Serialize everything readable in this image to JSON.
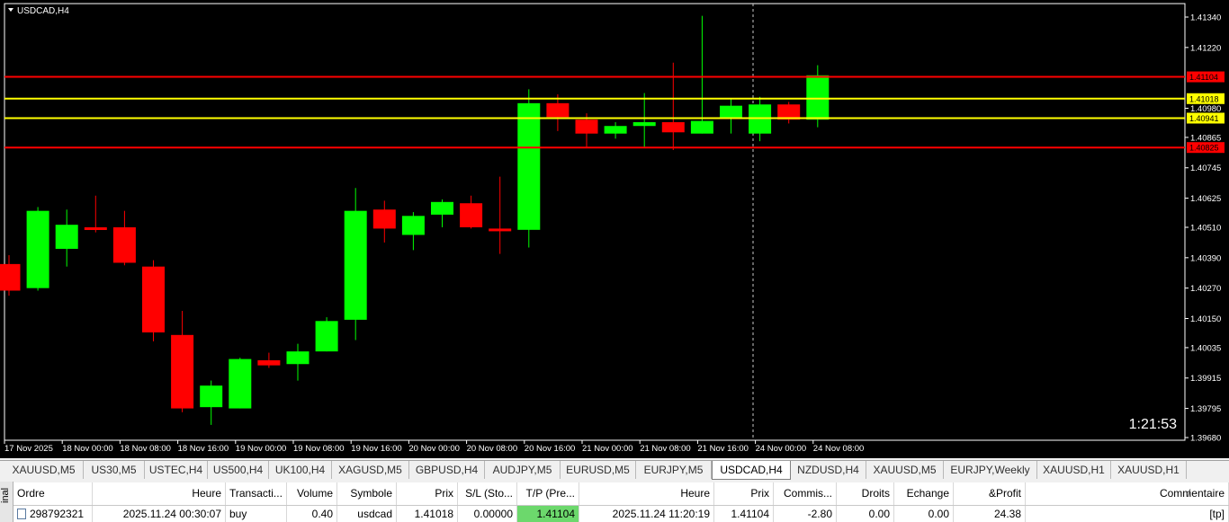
{
  "chart": {
    "title": "USDCAD,H4",
    "countdown": "1:21:53",
    "price_labels": [
      "1.41340",
      "1.41220",
      "1.40980",
      "1.40865",
      "1.40745",
      "1.40625",
      "1.40510",
      "1.40390",
      "1.40270",
      "1.40150",
      "1.40035",
      "1.39915",
      "1.39795",
      "1.39680"
    ],
    "time_labels": [
      "17 Nov 2025",
      "18 Nov 00:00",
      "18 Nov 08:00",
      "18 Nov 16:00",
      "19 Nov 00:00",
      "19 Nov 08:00",
      "19 Nov 16:00",
      "20 Nov 00:00",
      "20 Nov 08:00",
      "20 Nov 16:00",
      "21 Nov 00:00",
      "21 Nov 08:00",
      "21 Nov 16:00",
      "24 Nov 00:00",
      "24 Nov 08:00"
    ],
    "lines": [
      {
        "price": 1.41104,
        "label": "1.41104",
        "color": "#ff0000"
      },
      {
        "price": 1.41018,
        "label": "1.41018",
        "color": "#ffff00"
      },
      {
        "price": 1.40941,
        "label": "1.40941",
        "color": "#ffff00"
      },
      {
        "price": 1.40825,
        "label": "1.40825",
        "color": "#ff0000"
      }
    ],
    "colors": {
      "bull": "#00ff00",
      "bear": "#ff0000",
      "background": "#000000",
      "axis_text": "#ffffff"
    },
    "candles": [
      {
        "o": 1.40365,
        "h": 1.404,
        "l": 1.4024,
        "c": 1.4026
      },
      {
        "o": 1.4027,
        "h": 1.4059,
        "l": 1.4026,
        "c": 1.40575
      },
      {
        "o": 1.40425,
        "h": 1.4058,
        "l": 1.40355,
        "c": 1.4052
      },
      {
        "o": 1.4051,
        "h": 1.40635,
        "l": 1.4049,
        "c": 1.405
      },
      {
        "o": 1.4051,
        "h": 1.40575,
        "l": 1.4036,
        "c": 1.4037
      },
      {
        "o": 1.40355,
        "h": 1.4038,
        "l": 1.4006,
        "c": 1.40095
      },
      {
        "o": 1.40085,
        "h": 1.4018,
        "l": 1.3978,
        "c": 1.39795
      },
      {
        "o": 1.398,
        "h": 1.39905,
        "l": 1.3973,
        "c": 1.39885
      },
      {
        "o": 1.39795,
        "h": 1.39995,
        "l": 1.39795,
        "c": 1.3999
      },
      {
        "o": 1.39985,
        "h": 1.40015,
        "l": 1.39955,
        "c": 1.39965
      },
      {
        "o": 1.3997,
        "h": 1.4005,
        "l": 1.39905,
        "c": 1.4002
      },
      {
        "o": 1.4002,
        "h": 1.40155,
        "l": 1.4002,
        "c": 1.4014
      },
      {
        "o": 1.40145,
        "h": 1.40665,
        "l": 1.40065,
        "c": 1.40575
      },
      {
        "o": 1.4058,
        "h": 1.40615,
        "l": 1.4045,
        "c": 1.40505
      },
      {
        "o": 1.4048,
        "h": 1.4057,
        "l": 1.4042,
        "c": 1.40555
      },
      {
        "o": 1.4056,
        "h": 1.4062,
        "l": 1.4051,
        "c": 1.4061
      },
      {
        "o": 1.40605,
        "h": 1.40635,
        "l": 1.40505,
        "c": 1.4051
      },
      {
        "o": 1.40505,
        "h": 1.4071,
        "l": 1.40405,
        "c": 1.405
      },
      {
        "o": 1.405,
        "h": 1.41055,
        "l": 1.4043,
        "c": 1.41
      },
      {
        "o": 1.41,
        "h": 1.41035,
        "l": 1.4089,
        "c": 1.40945
      },
      {
        "o": 1.40935,
        "h": 1.4096,
        "l": 1.40825,
        "c": 1.4088
      },
      {
        "o": 1.4088,
        "h": 1.40925,
        "l": 1.4086,
        "c": 1.4091
      },
      {
        "o": 1.4091,
        "h": 1.4104,
        "l": 1.40825,
        "c": 1.40925
      },
      {
        "o": 1.40925,
        "h": 1.4116,
        "l": 1.40815,
        "c": 1.40885
      },
      {
        "o": 1.4088,
        "h": 1.41345,
        "l": 1.4088,
        "c": 1.4093
      },
      {
        "o": 1.4094,
        "h": 1.4102,
        "l": 1.4088,
        "c": 1.4099
      },
      {
        "o": 1.4088,
        "h": 1.41025,
        "l": 1.4085,
        "c": 1.40995
      },
      {
        "o": 1.40995,
        "h": 1.41005,
        "l": 1.4092,
        "c": 1.40935
      },
      {
        "o": 1.40935,
        "h": 1.4115,
        "l": 1.40905,
        "c": 1.4111
      }
    ]
  },
  "tabs": [
    "XAUUSD,M5",
    "US30,M5",
    "USTEC,H4",
    "US500,H4",
    "UK100,H4",
    "XAGUSD,M5",
    "GBPUSD,H4",
    "AUDJPY,M5",
    "EURUSD,M5",
    "EURJPY,M5",
    "USDCAD,H4",
    "NZDUSD,H4",
    "XAUUSD,M5",
    "EURJPY,Weekly",
    "XAUUSD,H1",
    "XAUUSD,H1"
  ],
  "active_tab": "USDCAD,H4",
  "terminal": {
    "side_label": "inal",
    "columns": [
      "Ordre",
      "Heure",
      "Transacti...",
      "Volume",
      "Symbole",
      "Prix",
      "S/L (Sto...",
      "T/P (Pre...",
      "Heure",
      "Prix",
      "Commis...",
      "Droits",
      "Echange",
      "&Profit",
      "Commentaire"
    ],
    "row": [
      "298792321",
      "2025.11.24 00:30:07",
      "buy",
      "0.40",
      "usdcad",
      "1.41018",
      "0.00000",
      "1.41104",
      "2025.11.24 11:20:19",
      "1.41104",
      "-2.80",
      "0.00",
      "0.00",
      "24.38",
      "[tp]"
    ],
    "sort_indicator": "/"
  }
}
